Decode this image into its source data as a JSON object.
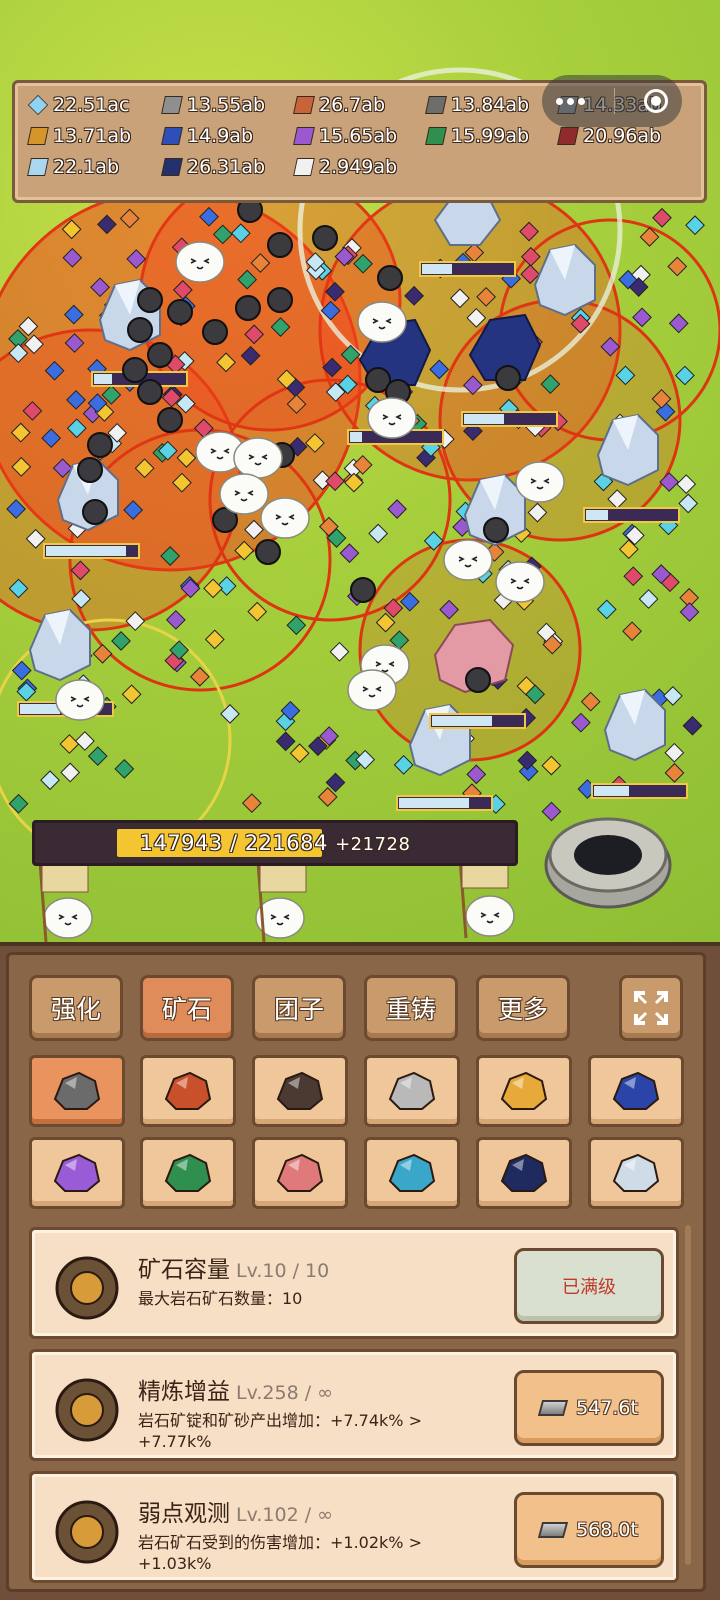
{
  "wallet": {
    "items": [
      {
        "value": "22.51ac",
        "icon": "diamond-icon",
        "color": "#8fd3f4"
      },
      {
        "value": "13.55ab",
        "icon": "iron-ingot-icon",
        "color": "#8f8f8f"
      },
      {
        "value": "26.7ab",
        "icon": "copper-ingot-icon",
        "color": "#c8633a"
      },
      {
        "value": "13.84ab",
        "icon": "steel-ingot-icon",
        "color": "#6d6d6d"
      },
      {
        "value": "14.33ab",
        "icon": "silver-ingot-icon",
        "color": "#9aa0a6"
      },
      {
        "value": "13.71ab",
        "icon": "gold-ingot-icon",
        "color": "#d4952a"
      },
      {
        "value": "14.9ab",
        "icon": "sapphire-ingot-icon",
        "color": "#2e4fb8"
      },
      {
        "value": "15.65ab",
        "icon": "amethyst-ingot-icon",
        "color": "#9b59d0"
      },
      {
        "value": "15.99ab",
        "icon": "emerald-ingot-icon",
        "color": "#2f8f4e"
      },
      {
        "value": "20.96ab",
        "icon": "ruby-ingot-icon",
        "color": "#8e2c2c"
      },
      {
        "value": "22.1ab",
        "icon": "aquamarine-ingot-icon",
        "color": "#a9d7ef"
      },
      {
        "value": "26.31ab",
        "icon": "obsidian-ingot-icon",
        "color": "#22306e"
      },
      {
        "value": "2.949ab",
        "icon": "quartz-ingot-icon",
        "color": "#f1f1f1"
      }
    ]
  },
  "progress": {
    "current": "147943",
    "separator": " / ",
    "max": "221684",
    "rate": "+21728",
    "fraction": 0.667
  },
  "tabs": [
    {
      "label": "强化",
      "active": false
    },
    {
      "label": "矿石",
      "active": true
    },
    {
      "label": "团子",
      "active": false
    },
    {
      "label": "重铸",
      "active": false
    },
    {
      "label": "更多",
      "active": false
    }
  ],
  "fullscreen_icon": "expand-icon",
  "ore_slots": [
    {
      "icon": "stone-ore-icon",
      "color": "#6b6b6b"
    },
    {
      "icon": "copper-ore-icon",
      "color": "#c8502a"
    },
    {
      "icon": "coal-ore-icon",
      "color": "#4a3a32"
    },
    {
      "icon": "silver-ore-icon",
      "color": "#b9b9b9"
    },
    {
      "icon": "gold-ore-icon",
      "color": "#e6a93a"
    },
    {
      "icon": "lapis-ore-icon",
      "color": "#2a44a8"
    },
    {
      "icon": "amethyst-ore-icon",
      "color": "#9a5bd6"
    },
    {
      "icon": "emerald-ore-icon",
      "color": "#2f8f4e"
    },
    {
      "icon": "rose-quartz-ore-icon",
      "color": "#e07a7a"
    },
    {
      "icon": "aquamarine-ore-icon",
      "color": "#3aa6c9"
    },
    {
      "icon": "obsidian-ore-icon",
      "color": "#1f2a5e"
    },
    {
      "icon": "diamond-ore-icon",
      "color": "#cfdce8"
    }
  ],
  "upgrades": [
    {
      "title": "矿石容量",
      "level": "Lv.10 / 10",
      "desc": "最大岩石矿石数量：10",
      "button": "已满级",
      "maxed": true,
      "icon": "ore-capacity-icon"
    },
    {
      "title": "精炼增益",
      "level": "Lv.258 / ∞",
      "desc": "岩石矿锭和矿砂产出增加：+7.74k% > +7.77k%",
      "button": "547.6t",
      "maxed": false,
      "icon": "refinery-furnace-icon"
    },
    {
      "title": "弱点观测",
      "level": "Lv.102 / ∞",
      "desc": "岩石矿石受到的伤害增加：+1.02k% > +1.03k%",
      "button": "568.0t",
      "maxed": false,
      "icon": "weakness-target-icon"
    }
  ]
}
